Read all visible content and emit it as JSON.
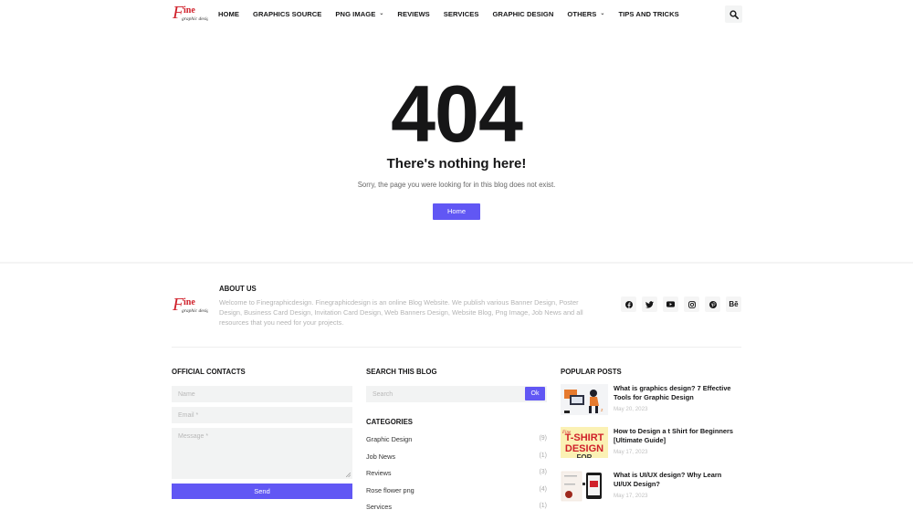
{
  "header": {
    "logo_alt": "Fine Graphic Design",
    "nav": [
      {
        "label": "HOME",
        "dropdown": false
      },
      {
        "label": "GRAPHICS SOURCE",
        "dropdown": false
      },
      {
        "label": "PNG IMAGE",
        "dropdown": true
      },
      {
        "label": "REVIEWS",
        "dropdown": false
      },
      {
        "label": "SERVICES",
        "dropdown": false
      },
      {
        "label": "GRAPHIC DESIGN",
        "dropdown": false
      },
      {
        "label": "OTHERS",
        "dropdown": true
      },
      {
        "label": "TIPS AND TRICKS",
        "dropdown": false
      }
    ],
    "search_icon": "search-icon"
  },
  "error": {
    "code": "404",
    "title": "There's nothing here!",
    "message": "Sorry, the page you were looking for in this blog does not exist.",
    "home_label": "Home"
  },
  "footer": {
    "about": {
      "title": "ABOUT US",
      "text": "Welcome to Finegraphicdesign. Finegraphicdesign is an online Blog Website. We publish various Banner Design, Poster Design, Business Card Design, Invitation Card Design, Web Banners Design, Website Blog, Png Image, Job News and all resources that you need for your projects."
    },
    "socials": [
      {
        "name": "facebook-icon",
        "glyph": "f"
      },
      {
        "name": "twitter-icon",
        "glyph": "t"
      },
      {
        "name": "youtube-icon",
        "glyph": "y"
      },
      {
        "name": "instagram-icon",
        "glyph": "i"
      },
      {
        "name": "pinterest-icon",
        "glyph": "p"
      },
      {
        "name": "behance-icon",
        "glyph": "Bē"
      }
    ],
    "contacts": {
      "title": "OFFICIAL CONTACTS",
      "name_placeholder": "Name",
      "email_placeholder": "Email *",
      "message_placeholder": "Message *",
      "send_label": "Send"
    },
    "search": {
      "title": "SEARCH THIS BLOG",
      "placeholder": "Search",
      "ok_label": "Ok"
    },
    "categories": {
      "title": "CATEGORIES",
      "items": [
        {
          "label": "Graphic Design",
          "count": "(9)"
        },
        {
          "label": "Job News",
          "count": "(1)"
        },
        {
          "label": "Reviews",
          "count": "(3)"
        },
        {
          "label": "Rose flower png",
          "count": "(4)"
        },
        {
          "label": "Services",
          "count": "(1)"
        }
      ]
    },
    "popular": {
      "title": "POPULAR POSTS",
      "posts": [
        {
          "title": "What is graphics design? 7 Effective Tools for Graphic Design",
          "date": "May 20, 2023"
        },
        {
          "title": "How to Design a t Shirt for Beginners [Ultimate Guide]",
          "date": "May 17, 2023",
          "thumb_text": "T-SHIRT DESIGN"
        },
        {
          "title": "What is UI/UX design? Why Learn UI/UX Design?",
          "date": "May 17, 2023"
        }
      ]
    }
  },
  "colors": {
    "accent": "#6157f4",
    "logo_red": "#d0202a",
    "text": "#161617",
    "muted": "#b4b4b4",
    "input_bg": "#f2f3f3"
  }
}
